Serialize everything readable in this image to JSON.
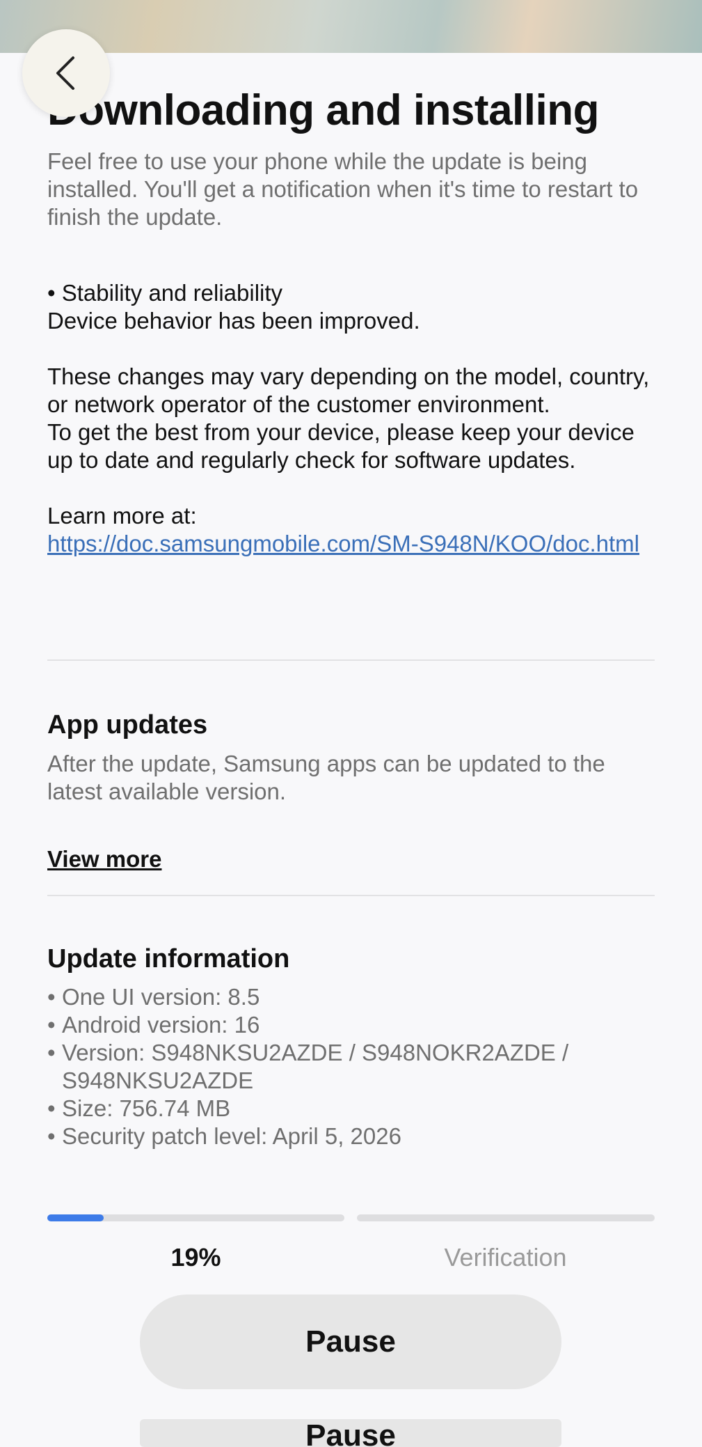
{
  "header": {
    "title": "Downloading and installing",
    "subtitle": "Feel free to use your phone while the update is being installed. You'll get a notification when it's time to restart to finish the update."
  },
  "release_notes": {
    "item_title": "• Stability and reliability",
    "item_desc": "Device behavior has been improved.",
    "disclaimer_1": "These changes may vary depending on the model, country, or network operator of the customer environment.",
    "disclaimer_2": "To get the best from your device, please keep your device up to date and regularly check for software updates.",
    "learn_more_label": "Learn more at:",
    "learn_more_link": "https://doc.samsungmobile.com/SM-S948N/KOO/doc.html"
  },
  "app_updates": {
    "title": "App updates",
    "description": "After the update, Samsung apps can be updated to the latest available version.",
    "view_more": "View more"
  },
  "update_info": {
    "title": "Update information",
    "items": [
      "One UI version: 8.5",
      "Android version: 16",
      "Version: S948NKSU2AZDE / S948NOKR2AZDE / S948NKSU2AZDE",
      "Size: 756.74 MB",
      "Security patch level: April 5, 2026"
    ]
  },
  "progress": {
    "percent_value": 0.19,
    "percent_label": "19%",
    "next_step_label": "Verification",
    "accent": "#3d7be8"
  },
  "actions": {
    "pause_label": "Pause"
  },
  "icons": {
    "back": "chevron-left-icon"
  }
}
